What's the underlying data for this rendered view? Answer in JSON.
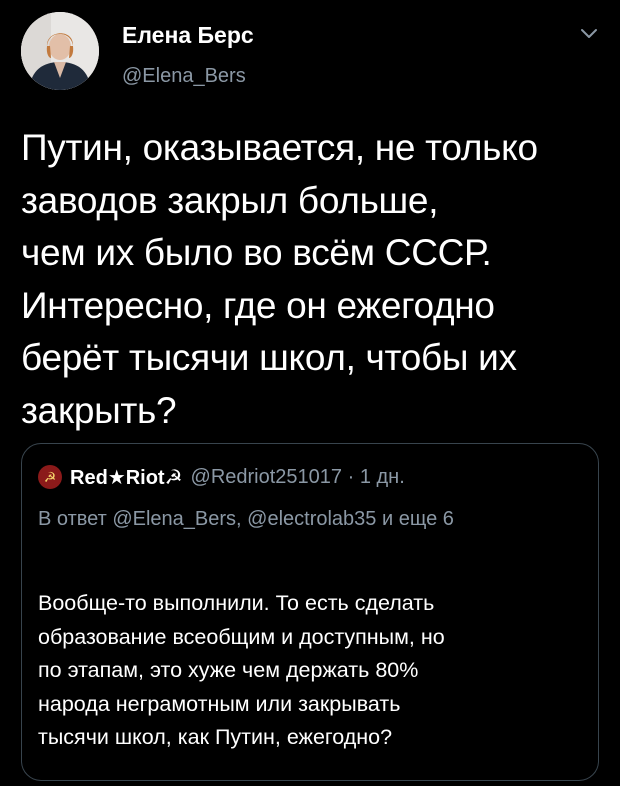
{
  "tweet": {
    "author": {
      "name": "Елена Берс",
      "handle": "@Elena_Bers"
    },
    "text_lines": [
      "Путин, оказывается, не только",
      "заводов закрыл больше,",
      "чем их было во всём СССР.",
      "Интересно, где он ежегодно",
      "берёт тысячи школ, чтобы их",
      "закрыть?"
    ]
  },
  "quoted_tweet": {
    "author_name": "Red★Riot☭",
    "meta": "@Redriot251017 · 1 дн.",
    "reply_prefix": "В ответ ",
    "reply_mention_1": "@Elena_Bers",
    "reply_sep": ", ",
    "reply_mention_2": "@electrolab35",
    "reply_suffix": " и еще 6",
    "text_lines": [
      "Вообще-то выполнили. То есть сделать",
      "образование всеобщим и доступным, но",
      "по этапам, это хуже чем держать 80%",
      "народа неграмотным или закрывать",
      "тысячи школ, как Путин, ежегодно?"
    ]
  },
  "colors": {
    "background": "#000000",
    "text": "#ffffff",
    "secondary": "#8b98a5",
    "border": "#38444d"
  },
  "icons": {
    "menu": "chevron-down-icon",
    "avatar": "user-avatar",
    "quoted_avatar": "hammer-sickle-avatar"
  }
}
